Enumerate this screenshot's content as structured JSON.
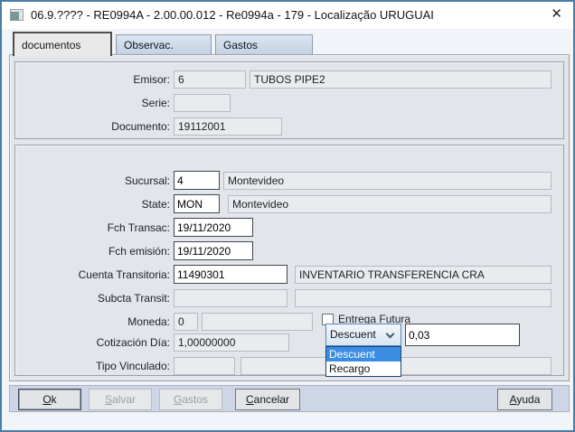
{
  "window": {
    "title": "06.9.???? - RE0994A - 2.00.00.012 - Re0994a - 179 - Localização URUGUAI",
    "close_glyph": "✕"
  },
  "tabs": {
    "documentos": "documentos",
    "observac": "Observac.",
    "gastos": "Gastos"
  },
  "doc": {
    "emisor_label": "Emisor:",
    "emisor_code": "6",
    "emisor_name": "TUBOS PIPE2",
    "serie_label": "Serie:",
    "serie_value": "",
    "documento_label": "Documento:",
    "documento_value": "19112001"
  },
  "detail": {
    "sucursal_label": "Sucursal:",
    "sucursal_code": "4",
    "sucursal_name": "Montevideo",
    "state_label": "State:",
    "state_code": "MON",
    "state_name": "Montevideo",
    "fch_transac_label": "Fch Transac:",
    "fch_transac_value": "19/11/2020",
    "fch_emision_label": "Fch emisión:",
    "fch_emision_value": "19/11/2020",
    "cuenta_label": "Cuenta Transitoria:",
    "cuenta_code": "11490301",
    "cuenta_name": "INVENTARIO TRANSFERENCIA CRA",
    "subcta_label": "Subcta Transit:",
    "subcta_code": "",
    "subcta_name": "",
    "moneda_label": "Moneda:",
    "moneda_code": "0",
    "moneda_extra": "",
    "entrega_label": "Entrega Futura",
    "cotizacion_label": "Cotización Día:",
    "cotizacion_value": "1,00000000",
    "tipo_label": "Tipo Vinculado:",
    "tipo_code": "",
    "tipo_name": ""
  },
  "combo": {
    "selected": "Descuent",
    "amount": "0,03",
    "options": [
      {
        "label": "Descuent"
      },
      {
        "label": "Recargo"
      }
    ]
  },
  "buttons": {
    "ok": "Ok",
    "salvar": "Salvar",
    "gastos": "Gastos",
    "cancelar": "Cancelar",
    "ayuda": "Ayuda"
  },
  "colors": {
    "window_border": "#4b7da4",
    "selection": "#3b8de4",
    "tab_fill": "#cdd9ea",
    "panel": "#e2e5ea",
    "button_bar": "#cdd5e7"
  }
}
